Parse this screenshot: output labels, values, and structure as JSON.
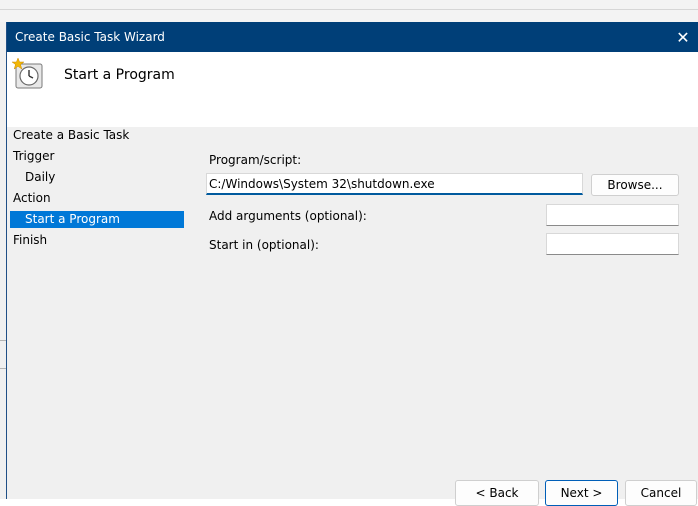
{
  "dialog": {
    "title": "Create Basic Task Wizard",
    "close_glyph": "✕",
    "heading": "Start a Program",
    "header_icon": "task-scheduler-clock-icon"
  },
  "steps": [
    {
      "label": "Create a Basic Task",
      "indent": false,
      "selected": false
    },
    {
      "label": "Trigger",
      "indent": false,
      "selected": false
    },
    {
      "label": "Daily",
      "indent": true,
      "selected": false
    },
    {
      "label": "Action",
      "indent": false,
      "selected": false
    },
    {
      "label": "Start a Program",
      "indent": true,
      "selected": true
    },
    {
      "label": "Finish",
      "indent": false,
      "selected": false
    }
  ],
  "form": {
    "program_label": "Program/script:",
    "program_value": "C:/Windows\\System 32\\shutdown.exe",
    "browse_label": "Browse...",
    "arguments_label": "Add arguments (optional):",
    "arguments_value": "",
    "startin_label": "Start in (optional):",
    "startin_value": ""
  },
  "footer": {
    "back_label": "< Back",
    "next_label": "Next >",
    "cancel_label": "Cancel"
  },
  "colors": {
    "titlebar": "#003f78",
    "selection": "#0078d7",
    "panel": "#f0f0f0"
  }
}
